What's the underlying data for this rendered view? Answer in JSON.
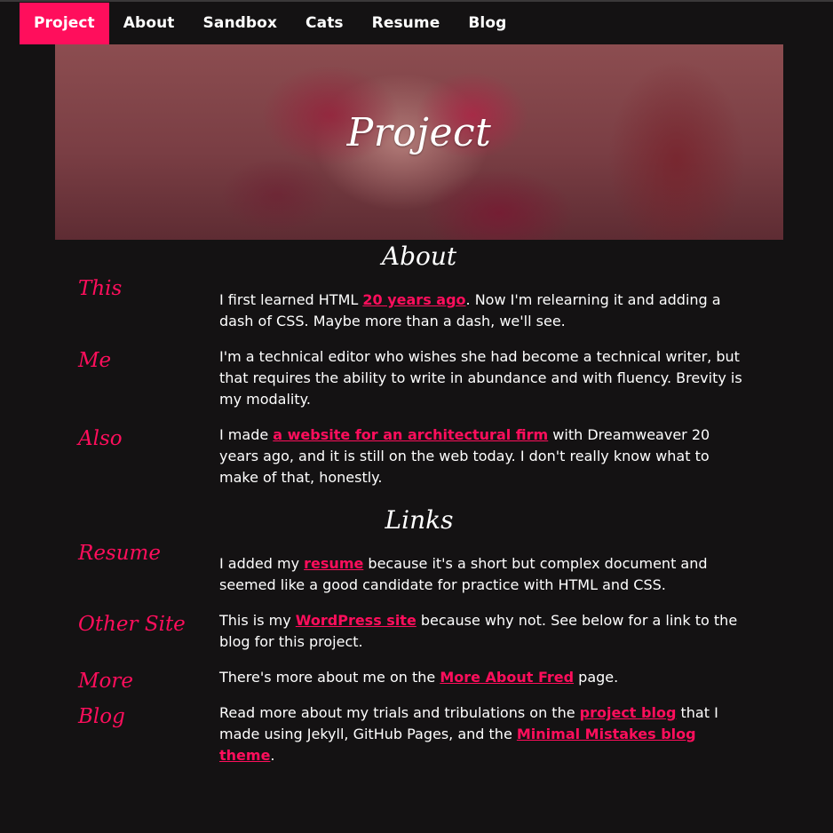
{
  "nav": {
    "items": [
      {
        "label": "Project",
        "active": true
      },
      {
        "label": "About"
      },
      {
        "label": "Sandbox"
      },
      {
        "label": "Cats"
      },
      {
        "label": "Resume"
      },
      {
        "label": "Blog"
      }
    ]
  },
  "hero": {
    "title": "Project"
  },
  "about": {
    "heading": "About",
    "rows": [
      {
        "label": "This",
        "before": "I first learned HTML ",
        "link": "20 years ago",
        "after": ". Now I'm relearning it and adding a dash of CSS. Maybe more than a dash, we'll see."
      },
      {
        "label": "Me",
        "text": "I'm a technical editor who wishes she had become a technical writer, but that requires the ability to write in abundance and with fluency. Brevity is my modality."
      },
      {
        "label": "Also",
        "before": "I made ",
        "link": "a website for an architectural firm",
        "after": " with Dreamweaver 20 years ago, and it is still on the web today. I don't really know what to make of that, honestly."
      }
    ]
  },
  "links": {
    "heading": "Links",
    "rows": [
      {
        "label": "Resume",
        "before": "I added my ",
        "link": "resume",
        "after": " because it's a short but complex document and seemed like a good candidate for practice with HTML and CSS."
      },
      {
        "label": "Other Site",
        "before": "This is my ",
        "link": "WordPress site",
        "after": " because why not. See below for a link to the blog for this project."
      },
      {
        "label": "More",
        "before": "There's more about me on the ",
        "link": "More About Fred",
        "after": " page."
      },
      {
        "label": "Blog",
        "before": "Read more about my trials and tribulations on the ",
        "link": "project blog",
        "middle": " that I made using Jekyll, GitHub Pages, and the ",
        "link2": "Minimal Mistakes blog theme",
        "after": "."
      }
    ]
  },
  "colors": {
    "background": "#141213",
    "accent": "#ff0e5c",
    "text": "#ffffff"
  }
}
